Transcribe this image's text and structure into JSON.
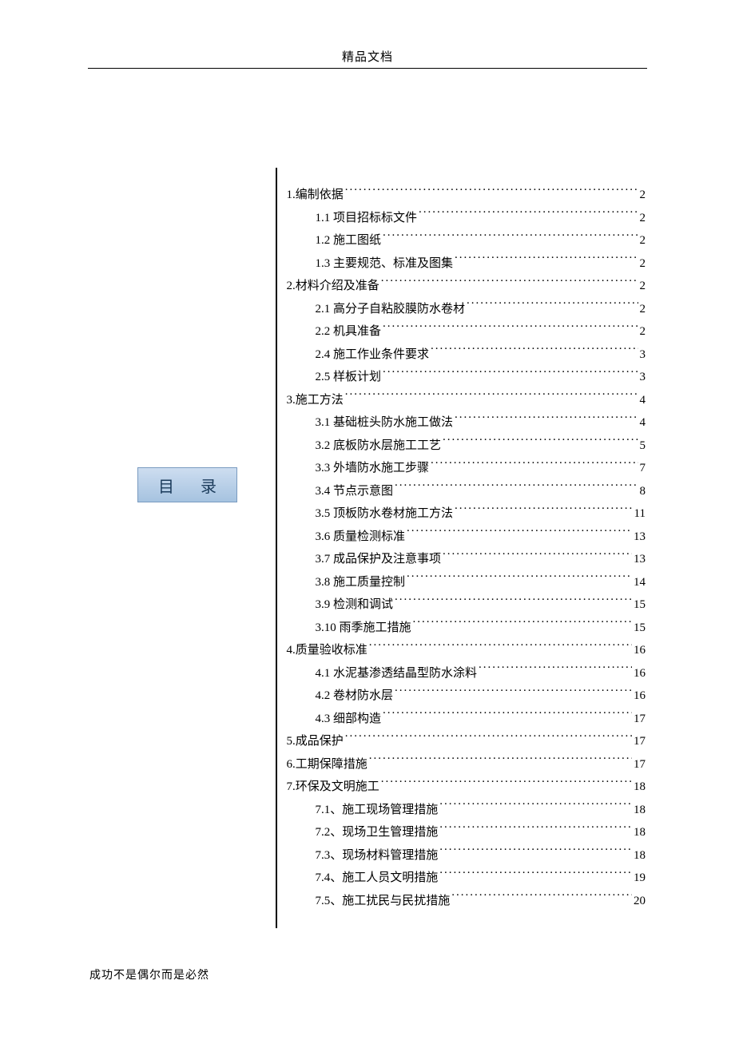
{
  "header": "精品文档",
  "toc_title": "目 录",
  "footer": "成功不是偶尔而是必然",
  "toc": [
    {
      "level": 1,
      "label": "1.编制依据",
      "page": "2"
    },
    {
      "level": 2,
      "label": "1.1 项目招标标文件",
      "page": "2"
    },
    {
      "level": 2,
      "label": "1.2 施工图纸",
      "page": "2"
    },
    {
      "level": 2,
      "label": "1.3 主要规范、标准及图集",
      "page": "2"
    },
    {
      "level": 1,
      "label": "2.材料介绍及准备",
      "page": "2"
    },
    {
      "level": 2,
      "label": "2.1  高分子自粘胶膜防水卷材",
      "page": "2"
    },
    {
      "level": 2,
      "label": "2.2 机具准备",
      "page": "2"
    },
    {
      "level": 2,
      "label": "2.4  施工作业条件要求",
      "page": "3"
    },
    {
      "level": 2,
      "label": "2.5  样板计划",
      "page": "3"
    },
    {
      "level": 1,
      "label": "3.施工方法",
      "page": "4"
    },
    {
      "level": 2,
      "label": "3.1 基础桩头防水施工做法",
      "page": "4"
    },
    {
      "level": 2,
      "label": "3.2 底板防水层施工工艺",
      "page": "5"
    },
    {
      "level": 2,
      "label": "3.3 外墙防水施工步骤",
      "page": "7"
    },
    {
      "level": 2,
      "label": "3.4 节点示意图",
      "page": "8"
    },
    {
      "level": 2,
      "label": "3.5 顶板防水卷材施工方法",
      "page": "11"
    },
    {
      "level": 2,
      "label": "3.6  质量检测标准",
      "page": "13"
    },
    {
      "level": 2,
      "label": "3.7  成品保护及注意事项",
      "page": "13"
    },
    {
      "level": 2,
      "label": "3.8 施工质量控制",
      "page": "14"
    },
    {
      "level": 2,
      "label": "3.9  检测和调试",
      "page": "15"
    },
    {
      "level": 2,
      "label": "3.10  雨季施工措施",
      "page": "15"
    },
    {
      "level": 1,
      "label": "4.质量验收标准",
      "page": "16"
    },
    {
      "level": 2,
      "label": "4.1 水泥基渗透结晶型防水涂料",
      "page": "16"
    },
    {
      "level": 2,
      "label": "4.2 卷材防水层",
      "page": "16"
    },
    {
      "level": 2,
      "label": "4.3 细部构造",
      "page": "17"
    },
    {
      "level": 1,
      "label": "5.成品保护",
      "page": "17"
    },
    {
      "level": 1,
      "label": "6.工期保障措施",
      "page": "17"
    },
    {
      "level": 1,
      "label": "7.环保及文明施工",
      "page": "18"
    },
    {
      "level": 2,
      "label": "7.1、施工现场管理措施",
      "page": "18"
    },
    {
      "level": 2,
      "label": "7.2、现场卫生管理措施",
      "page": "18"
    },
    {
      "level": 2,
      "label": "7.3、现场材料管理措施",
      "page": "18"
    },
    {
      "level": 2,
      "label": "7.4、施工人员文明措施",
      "page": "19"
    },
    {
      "level": 2,
      "label": "7.5、施工扰民与民扰措施",
      "page": "20"
    }
  ]
}
